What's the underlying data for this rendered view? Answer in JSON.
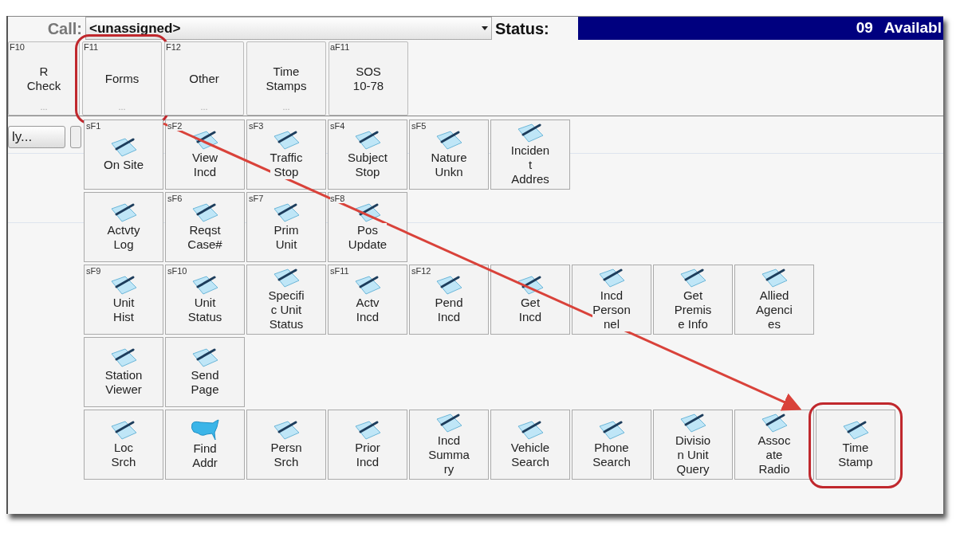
{
  "top_bar": {
    "call_label": "Call:",
    "call_value": "<unassigned>",
    "status_label": "Status:",
    "status_code": "09",
    "status_text": "Availabl"
  },
  "function_keys": [
    {
      "hotkey": "F10",
      "lines": [
        "R",
        "Check"
      ],
      "menu_marker": "...",
      "highlighted": false
    },
    {
      "hotkey": "F11",
      "lines": [
        "Forms"
      ],
      "menu_marker": "...",
      "highlighted": true
    },
    {
      "hotkey": "F12",
      "lines": [
        "Other"
      ],
      "menu_marker": "...",
      "highlighted": false
    },
    {
      "lines": [
        "Time",
        "Stamps"
      ],
      "menu_marker": "...",
      "highlighted": false
    },
    {
      "hotkey": "aF11",
      "lines": [
        "SOS",
        "10-78"
      ],
      "highlighted": false
    }
  ],
  "side_button": {
    "label": "ly..."
  },
  "tile_rows": [
    [
      {
        "kind": "form",
        "hotkey": "sF1",
        "lines": [
          "On Site"
        ],
        "highlighted": false
      },
      {
        "kind": "form",
        "hotkey": "sF2",
        "lines": [
          "View",
          "Incd"
        ],
        "highlighted": false
      },
      {
        "kind": "form",
        "hotkey": "sF3",
        "lines": [
          "Traffic",
          "Stop"
        ],
        "highlighted": false
      },
      {
        "kind": "form",
        "hotkey": "sF4",
        "lines": [
          "Subject",
          "Stop"
        ],
        "highlighted": false
      },
      {
        "kind": "form",
        "hotkey": "sF5",
        "lines": [
          "Nature",
          "Unkn"
        ],
        "highlighted": false
      },
      {
        "kind": "form",
        "lines": [
          "Inciden",
          "t",
          "Addres"
        ],
        "highlighted": false
      }
    ],
    [
      {
        "kind": "form",
        "lines": [
          "Actvty",
          "Log"
        ],
        "highlighted": false
      },
      {
        "kind": "form",
        "hotkey": "sF6",
        "lines": [
          "Reqst",
          "Case#"
        ],
        "highlighted": false
      },
      {
        "kind": "form",
        "hotkey": "sF7",
        "lines": [
          "Prim",
          "Unit"
        ],
        "highlighted": false
      },
      {
        "kind": "form",
        "hotkey": "sF8",
        "lines": [
          "Pos",
          "Update"
        ],
        "highlighted": false
      }
    ],
    [
      {
        "kind": "form",
        "hotkey": "sF9",
        "lines": [
          "Unit",
          "Hist"
        ],
        "highlighted": false
      },
      {
        "kind": "form",
        "hotkey": "sF10",
        "lines": [
          "Unit",
          "Status"
        ],
        "highlighted": false
      },
      {
        "kind": "form",
        "lines": [
          "Specifi",
          "c Unit",
          "Status"
        ],
        "highlighted": false
      },
      {
        "kind": "form",
        "hotkey": "sF11",
        "lines": [
          "Actv",
          "Incd"
        ],
        "highlighted": false
      },
      {
        "kind": "form",
        "hotkey": "sF12",
        "lines": [
          "Pend",
          "Incd"
        ],
        "highlighted": false
      },
      {
        "kind": "form",
        "lines": [
          "Get",
          "Incd"
        ],
        "highlighted": false
      },
      {
        "kind": "form",
        "lines": [
          "Incd",
          "Person",
          "nel"
        ],
        "highlighted": false
      },
      {
        "kind": "form",
        "lines": [
          "Get",
          "Premis",
          "e Info"
        ],
        "highlighted": false
      },
      {
        "kind": "form",
        "lines": [
          "Allied",
          "Agenci",
          "es"
        ],
        "highlighted": false
      }
    ],
    [
      {
        "kind": "form",
        "lines": [
          "Station",
          "Viewer"
        ],
        "highlighted": false
      },
      {
        "kind": "form",
        "lines": [
          "Send",
          "Page"
        ],
        "highlighted": false
      }
    ],
    [
      {
        "kind": "form",
        "lines": [
          "Loc",
          "Srch"
        ],
        "highlighted": false
      },
      {
        "kind": "map",
        "lines": [
          "Find",
          "Addr"
        ],
        "highlighted": false
      },
      {
        "kind": "form",
        "lines": [
          "Persn",
          "Srch"
        ],
        "highlighted": false
      },
      {
        "kind": "form",
        "lines": [
          "Prior",
          "Incd"
        ],
        "highlighted": false
      },
      {
        "kind": "form",
        "lines": [
          "Incd",
          "Summa",
          "ry"
        ],
        "highlighted": false
      },
      {
        "kind": "form",
        "lines": [
          "Vehicle",
          "Search"
        ],
        "highlighted": false
      },
      {
        "kind": "form",
        "lines": [
          "Phone",
          "Search"
        ],
        "highlighted": false
      },
      {
        "kind": "form",
        "lines": [
          "Divisio",
          "n Unit",
          "Query"
        ],
        "highlighted": false
      },
      {
        "kind": "form",
        "lines": [
          "Assoc",
          "ate",
          "Radio"
        ],
        "highlighted": false
      },
      {
        "kind": "form",
        "lines": [
          "Time",
          "Stamp"
        ],
        "highlighted": true
      }
    ]
  ],
  "callout_arrow": true
}
